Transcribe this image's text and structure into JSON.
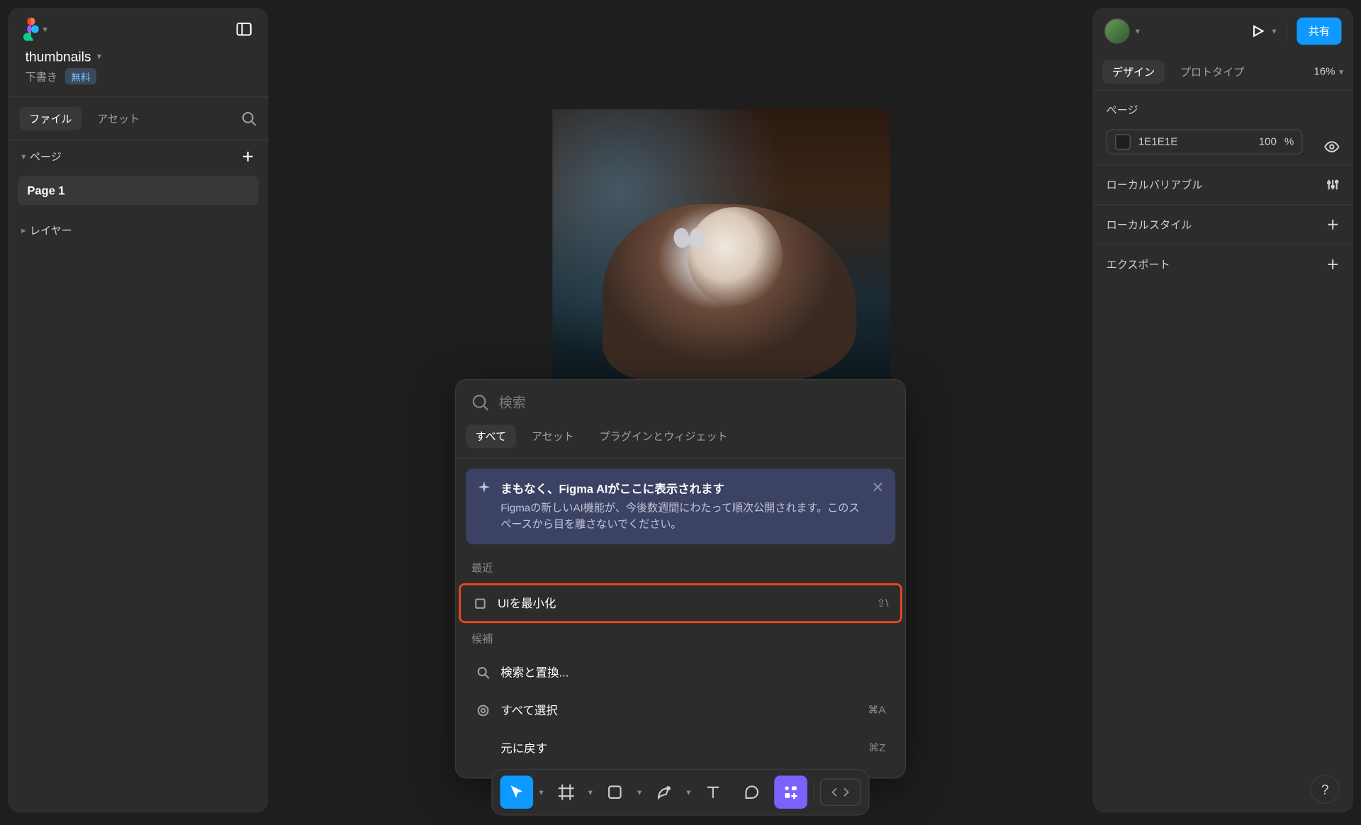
{
  "left": {
    "project_name": "thumbnails",
    "draft_label": "下書き",
    "plan_badge": "無料",
    "tabs": {
      "file": "ファイル",
      "assets": "アセット"
    },
    "pages_label": "ページ",
    "page_1": "Page 1",
    "layers_label": "レイヤー"
  },
  "right": {
    "share_label": "共有",
    "tabs": {
      "design": "デザイン",
      "prototype": "プロトタイプ"
    },
    "zoom": "16%",
    "section_page": "ページ",
    "bg_hex": "1E1E1E",
    "bg_opacity_value": "100",
    "bg_opacity_unit": "%",
    "section_local_vars": "ローカルバリアブル",
    "section_local_styles": "ローカルスタイル",
    "section_export": "エクスポート"
  },
  "qa": {
    "search_placeholder": "検索",
    "tabs": {
      "all": "すべて",
      "assets": "アセット",
      "plugins": "プラグインとウィジェット"
    },
    "banner": {
      "title": "まもなく、Figma AIがここに表示されます",
      "desc": "Figmaの新しいAI機能が、今後数週間にわたって順次公開されます。このスペースから目を離さないでください。"
    },
    "recent_label": "最近",
    "recent_item": {
      "label": "UIを最小化",
      "shortcut": "⇧\\"
    },
    "sugg_label": "候補",
    "sugg": [
      {
        "label": "検索と置換...",
        "shortcut": ""
      },
      {
        "label": "すべて選択",
        "shortcut": "⌘A"
      },
      {
        "label": "元に戻す",
        "shortcut": "⌘Z"
      }
    ]
  },
  "help_label": "?"
}
